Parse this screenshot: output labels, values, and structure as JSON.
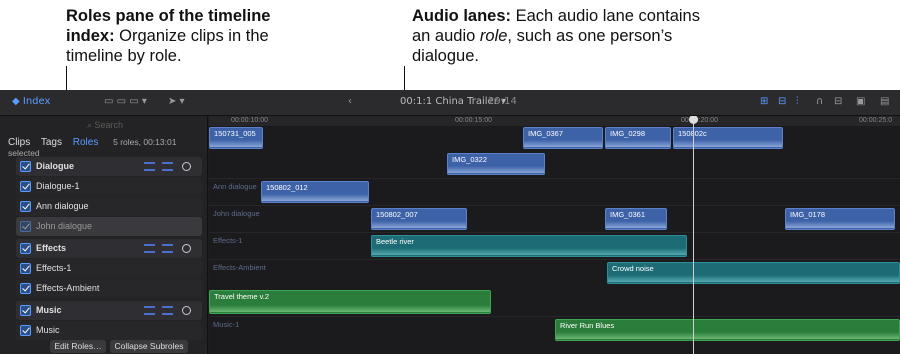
{
  "callouts": {
    "left_bold": "Roles pane of the timeline index:",
    "left_rest": " Organize clips in the timeline by role.",
    "right_bold": "Audio lanes:",
    "right_rest_1": " Each audio lane contains an audio ",
    "right_italic": "role",
    "right_rest_2": ", such as one person’s dialogue."
  },
  "toolbar": {
    "index_label": "Index",
    "project_title": "China Trailer",
    "timecode": "00:1:1",
    "duration": "29:14"
  },
  "sidebar": {
    "search_placeholder": "Search",
    "tabs": [
      "Clips",
      "Tags",
      "Roles"
    ],
    "active_tab": "Roles",
    "summary": "5 roles, 00:13:01 selected",
    "roles": [
      {
        "label": "Dialogue",
        "kind": "header"
      },
      {
        "label": "Dialogue-1",
        "kind": "sub"
      },
      {
        "label": "Ann dialogue",
        "kind": "sub"
      },
      {
        "label": "John dialogue",
        "kind": "selected"
      },
      {
        "label": "Effects",
        "kind": "header"
      },
      {
        "label": "Effects-1",
        "kind": "sub"
      },
      {
        "label": "Effects-Ambient",
        "kind": "sub"
      },
      {
        "label": "Music",
        "kind": "header"
      },
      {
        "label": "Music",
        "kind": "sub"
      }
    ],
    "edit_roles": "Edit Roles…",
    "collapse_subroles": "Collapse Subroles"
  },
  "ruler": {
    "marks": [
      "00:00:10:00",
      "00:00:15:00",
      "00:00:20:00",
      "00:00:25:0"
    ]
  },
  "lanes": {
    "ann_dialogue": "Ann dialogue",
    "john_dialogue": "John dialogue",
    "effects_1": "Effects-1",
    "effects_ambient": "Effects-Ambient",
    "music_1": "Music-1"
  },
  "clips": {
    "c1": "150731_005",
    "c2": "IMG_0367",
    "c3": "IMG_0298",
    "c4": "150802c",
    "c5": "IMG_0322",
    "c6": "150802_012",
    "c7": "150802_007",
    "c8": "IMG_0361",
    "c9": "IMG_0178",
    "c10": "Beetle river",
    "c11": "Crowd noise",
    "c12": "Travel theme v.2",
    "c13": "River Run Blues"
  }
}
